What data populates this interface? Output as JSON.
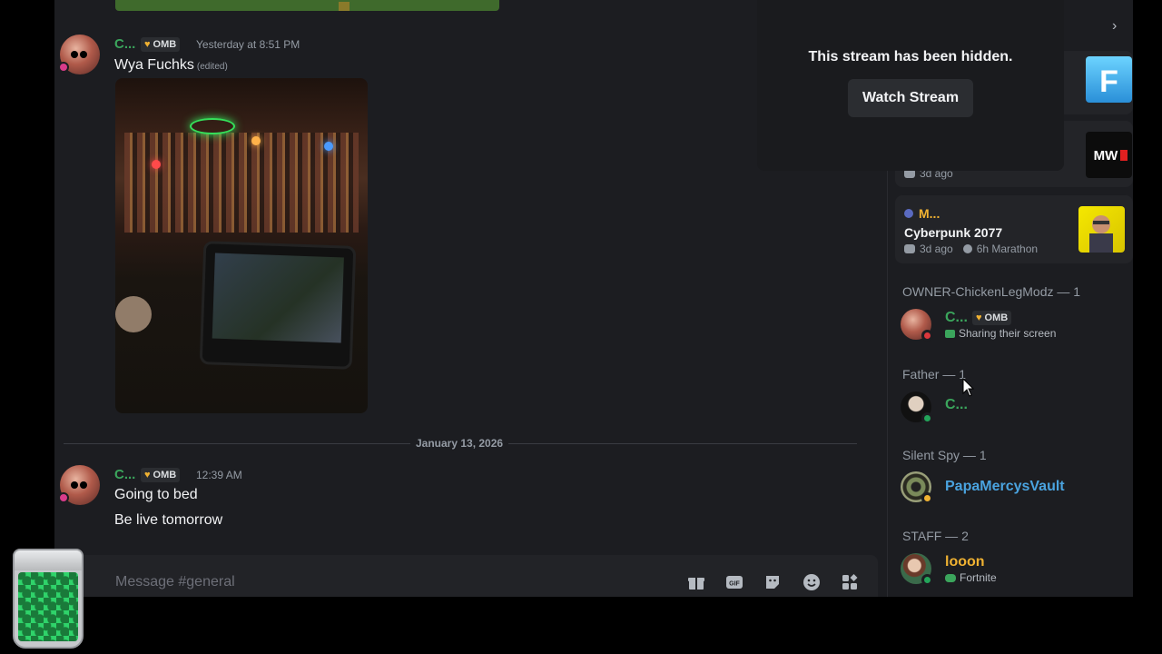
{
  "chat": {
    "messages": [
      {
        "author": "C...",
        "role": "OMB",
        "timestamp": "Yesterday at 8:51 PM",
        "lines": [
          "Wya Fuchks"
        ],
        "edited_label": "(edited)"
      },
      {
        "author": "C...",
        "role": "OMB",
        "timestamp": "12:39 AM",
        "lines": [
          "Going to bed",
          "Be live tomorrow"
        ]
      }
    ],
    "date_divider": "January 13, 2026",
    "composer": {
      "placeholder": "Message #general"
    }
  },
  "stream_overlay": {
    "message": "This stream has been hidden.",
    "watch_button": "Watch Stream"
  },
  "activity": {
    "cards": [
      {
        "meta": "3d ago",
        "thumb_label": "MW"
      },
      {
        "user": "M...",
        "game": "Cyberpunk 2077",
        "ago": "3d ago",
        "marathon": "6h Marathon"
      }
    ]
  },
  "members": {
    "sections": [
      {
        "title": "OWNER-ChickenLegModz — 1",
        "members": [
          {
            "name": "C...",
            "role": "OMB",
            "activity": "Sharing their screen"
          }
        ]
      },
      {
        "title": "Father — 1",
        "members": [
          {
            "name": "C..."
          }
        ]
      },
      {
        "title": "Silent Spy — 1",
        "members": [
          {
            "name": "PapaMercysVault"
          }
        ]
      },
      {
        "title": "STAFF — 2",
        "members": [
          {
            "name": "looon",
            "activity": "Fortnite"
          }
        ]
      }
    ]
  },
  "colors": {
    "green_name": "#3ba55c",
    "blue_name": "#4aa3df",
    "yellow_name": "#f0b232",
    "background": "#1c1d21"
  }
}
